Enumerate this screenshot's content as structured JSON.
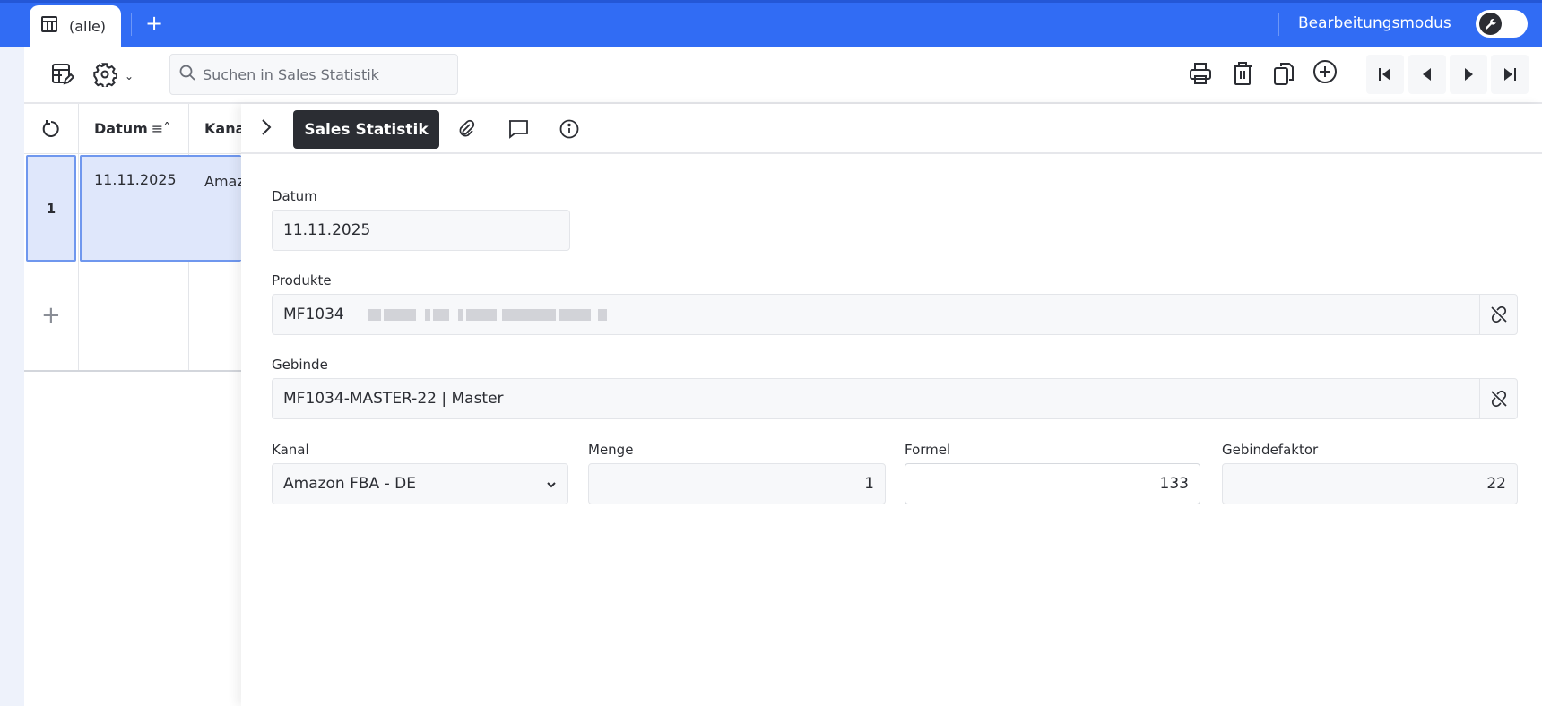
{
  "tabs": [
    {
      "label": "(alle)"
    }
  ],
  "topbar": {
    "mode_label": "Bearbeitungsmodus",
    "mode_enabled": true
  },
  "toolbar": {
    "search_placeholder": "Suchen in Sales Statistik"
  },
  "grid": {
    "columns": [
      "Datum",
      "Kanal"
    ],
    "column_truncated": [
      "Datum",
      "Kana"
    ],
    "rows": [
      {
        "num": "1",
        "datum": "11.11.2025",
        "kanal": "Amaz"
      }
    ]
  },
  "panel": {
    "title": "Sales Statistik"
  },
  "form": {
    "datum": {
      "label": "Datum",
      "value": "11.11.2025"
    },
    "produkte": {
      "label": "Produkte",
      "value": "MF1034"
    },
    "gebinde": {
      "label": "Gebinde",
      "value": "MF1034-MASTER-22 | Master"
    },
    "kanal": {
      "label": "Kanal",
      "value": "Amazon FBA - DE"
    },
    "menge": {
      "label": "Menge",
      "value": "1"
    },
    "formel": {
      "label": "Formel",
      "value": "133"
    },
    "gebindefaktor": {
      "label": "Gebindefaktor",
      "value": "22"
    }
  },
  "colors": {
    "accent": "#316cf4",
    "dark": "#2b2d33",
    "selection": "#dfe7fb"
  }
}
